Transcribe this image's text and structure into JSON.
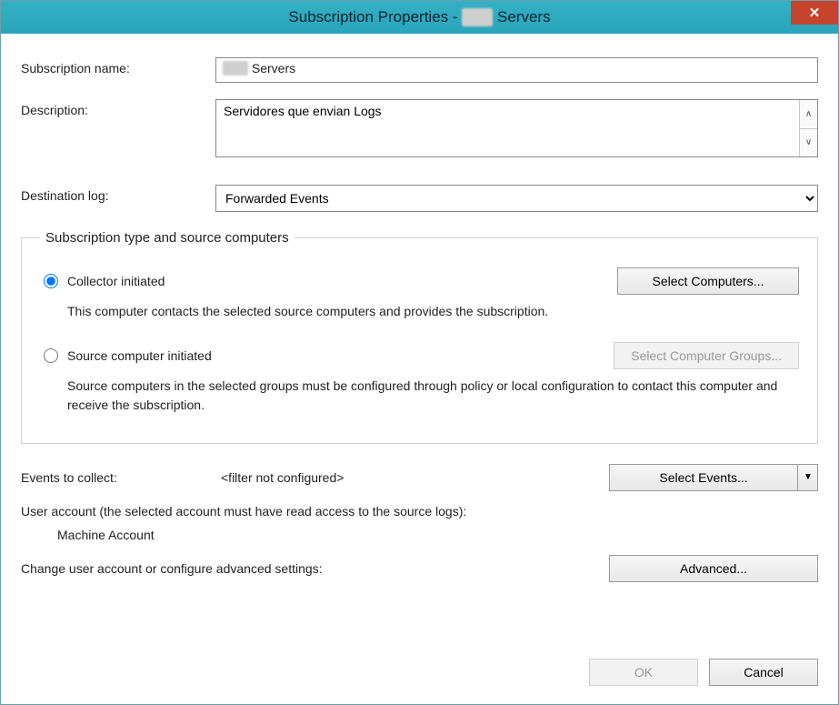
{
  "title_prefix": "Subscription Properties - ",
  "title_blur": "xxxx",
  "title_suffix": " Servers",
  "labels": {
    "subscription_name": "Subscription name:",
    "description": "Description:",
    "destination_log": "Destination log:",
    "events_to_collect": "Events to collect:",
    "change_settings": "Change user account or configure advanced settings:"
  },
  "fields": {
    "name_blur": "xxxx",
    "name_suffix": " Servers",
    "description_value": "Servidores que envian Logs",
    "destination_log_value": "Forwarded Events",
    "filter_status": "<filter not configured>",
    "user_account_line": "User account (the selected account must have read access to the source logs):",
    "user_account_value": "Machine Account"
  },
  "group": {
    "legend": "Subscription type and source computers",
    "collector_label": "Collector initiated",
    "collector_desc": "This computer contacts the selected source computers and provides the subscription.",
    "source_label": "Source computer initiated",
    "source_desc": "Source computers in the selected groups must be configured through policy or local configuration to contact this computer and receive the subscription.",
    "select_computers_btn": "Select Computers...",
    "select_groups_btn": "Select Computer Groups..."
  },
  "buttons": {
    "select_events": "Select Events...",
    "advanced": "Advanced...",
    "ok": "OK",
    "cancel": "Cancel"
  }
}
